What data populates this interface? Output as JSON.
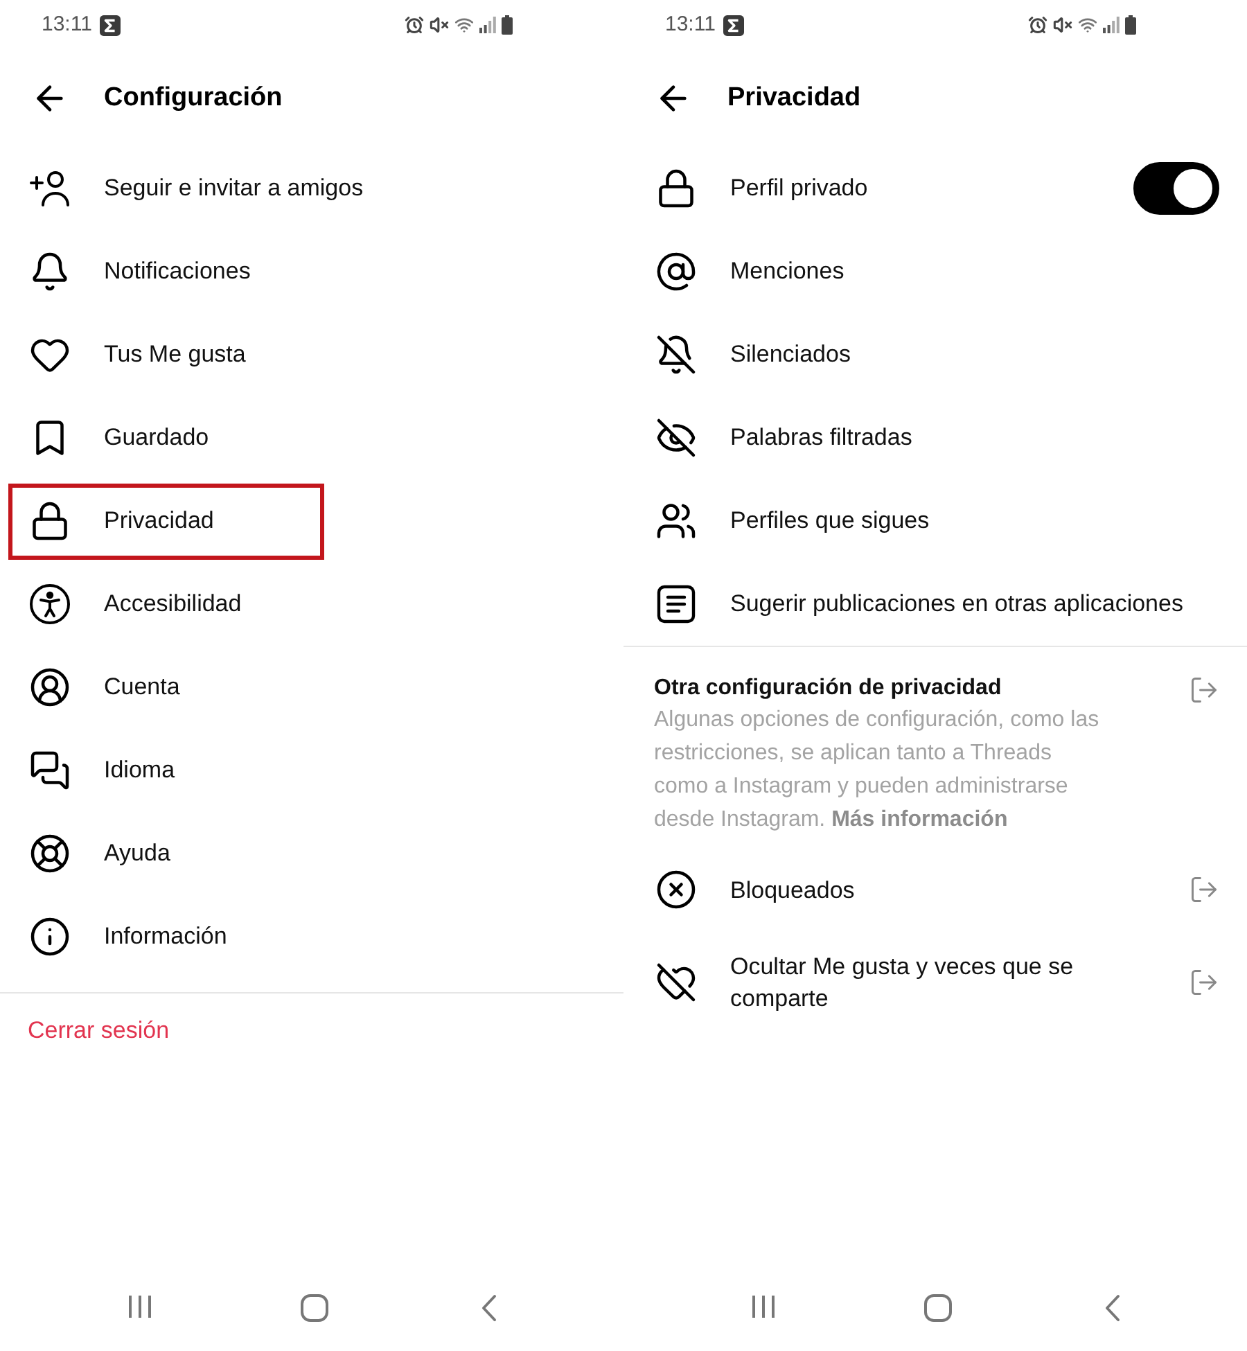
{
  "settings_screen": {
    "status_bar": {
      "time": "13:11"
    },
    "header": {
      "title": "Configuración"
    },
    "items": [
      {
        "label": "Seguir e invitar a amigos",
        "highlighted": false
      },
      {
        "label": "Notificaciones",
        "highlighted": false
      },
      {
        "label": "Tus Me gusta",
        "highlighted": false
      },
      {
        "label": "Guardado",
        "highlighted": false
      },
      {
        "label": "Privacidad",
        "highlighted": true
      },
      {
        "label": "Accesibilidad",
        "highlighted": false
      },
      {
        "label": "Cuenta",
        "highlighted": false
      },
      {
        "label": "Idioma",
        "highlighted": false
      },
      {
        "label": "Ayuda",
        "highlighted": false
      },
      {
        "label": "Información",
        "highlighted": false
      }
    ],
    "logout": {
      "label": "Cerrar sesión"
    }
  },
  "privacy_screen": {
    "status_bar": {
      "time": "13:11"
    },
    "header": {
      "title": "Privacidad"
    },
    "items": [
      {
        "kind": "toggle",
        "label": "Perfil privado",
        "on": true
      },
      {
        "kind": "nav",
        "label": "Menciones"
      },
      {
        "kind": "nav",
        "label": "Silenciados"
      },
      {
        "kind": "nav",
        "label": "Palabras filtradas"
      },
      {
        "kind": "nav",
        "label": "Perfiles que sigues"
      },
      {
        "kind": "nav",
        "label": "Sugerir publicaciones en otras aplicaciones"
      }
    ],
    "other_section": {
      "title": "Otra configuración de privacidad",
      "description": "Algunas opciones de configuración, como las restricciones, se aplican tanto a Threads como a Instagram y pueden administrarse desde Instagram.",
      "link": "Más información",
      "items": [
        {
          "label": "Bloqueados"
        },
        {
          "label": "Ocultar Me gusta y veces que se comparte"
        }
      ]
    }
  }
}
